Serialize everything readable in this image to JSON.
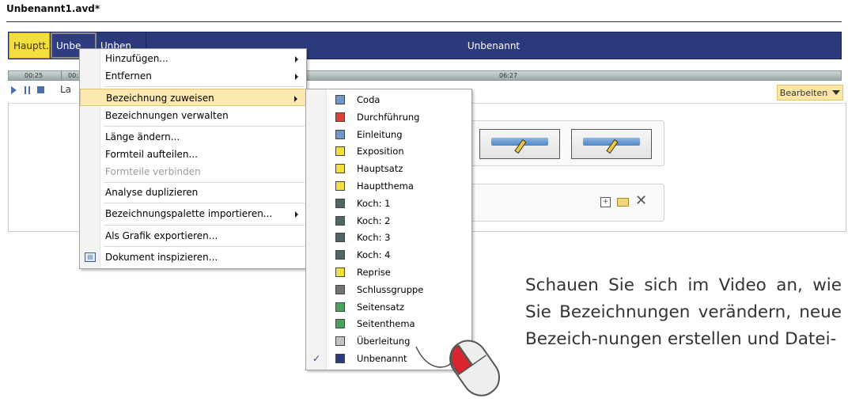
{
  "document": {
    "title": "Unbenannt1.avd*"
  },
  "form_bar": {
    "segments": [
      {
        "label": "Hauptt...",
        "color": "#f2de3c"
      },
      {
        "label": "Unbe",
        "color": "#2f3d80"
      },
      {
        "label": "Unben",
        "color": "#2b3a7a"
      },
      {
        "label": "Unbenannt",
        "color": "#2b3a7a"
      }
    ]
  },
  "ruler": {
    "ticks": [
      "00:25",
      "00:2",
      "06:27"
    ]
  },
  "toolbar": {
    "row_label": "La",
    "edit_label": "Bearbeiten"
  },
  "context_menu": {
    "items": [
      {
        "label": "Hinzufügen...",
        "submenu": true
      },
      {
        "label": "Entfernen",
        "submenu": true
      },
      {
        "label": "Bezeichnung zuweisen",
        "submenu": true,
        "selected": true
      },
      {
        "label": "Bezeichnungen verwalten"
      },
      {
        "label": "Länge ändern..."
      },
      {
        "label": "Formteil aufteilen..."
      },
      {
        "label": "Formteile verbinden",
        "disabled": true
      },
      {
        "label": "Analyse duplizieren"
      },
      {
        "label": "Bezeichnungspalette importieren...",
        "submenu": true
      },
      {
        "label": "Als Grafik exportieren..."
      },
      {
        "label": "Dokument inspizieren...",
        "icon": "inspect-document-icon"
      }
    ]
  },
  "label_submenu": {
    "items": [
      {
        "label": "Coda",
        "color": "#6f97c7"
      },
      {
        "label": "Durchführung",
        "color": "#e0403a"
      },
      {
        "label": "Einleitung",
        "color": "#6f97c7"
      },
      {
        "label": "Exposition",
        "color": "#f2de3c"
      },
      {
        "label": "Hauptsatz",
        "color": "#f2de3c"
      },
      {
        "label": "Hauptthema",
        "color": "#f2de3c"
      },
      {
        "label": "Koch: 1",
        "color": "#4f6566"
      },
      {
        "label": "Koch: 2",
        "color": "#4f6566"
      },
      {
        "label": "Koch: 3",
        "color": "#4f6566"
      },
      {
        "label": "Koch: 4",
        "color": "#4f6566"
      },
      {
        "label": "Reprise",
        "color": "#f2de3c"
      },
      {
        "label": "Schlussgruppe",
        "color": "#737373"
      },
      {
        "label": "Seitensatz",
        "color": "#49a45b"
      },
      {
        "label": "Seitenthema",
        "color": "#49a45b"
      },
      {
        "label": "Überleitung",
        "color": "#c4c4c4"
      },
      {
        "label": "Unbenannt",
        "color": "#2b3a7a",
        "checked": true
      }
    ]
  },
  "caption": {
    "text": "Schauen Sie sich im Video an, wie Sie Bezeichnungen verändern, neue Bezeich-nungen erstellen und Datei-"
  }
}
